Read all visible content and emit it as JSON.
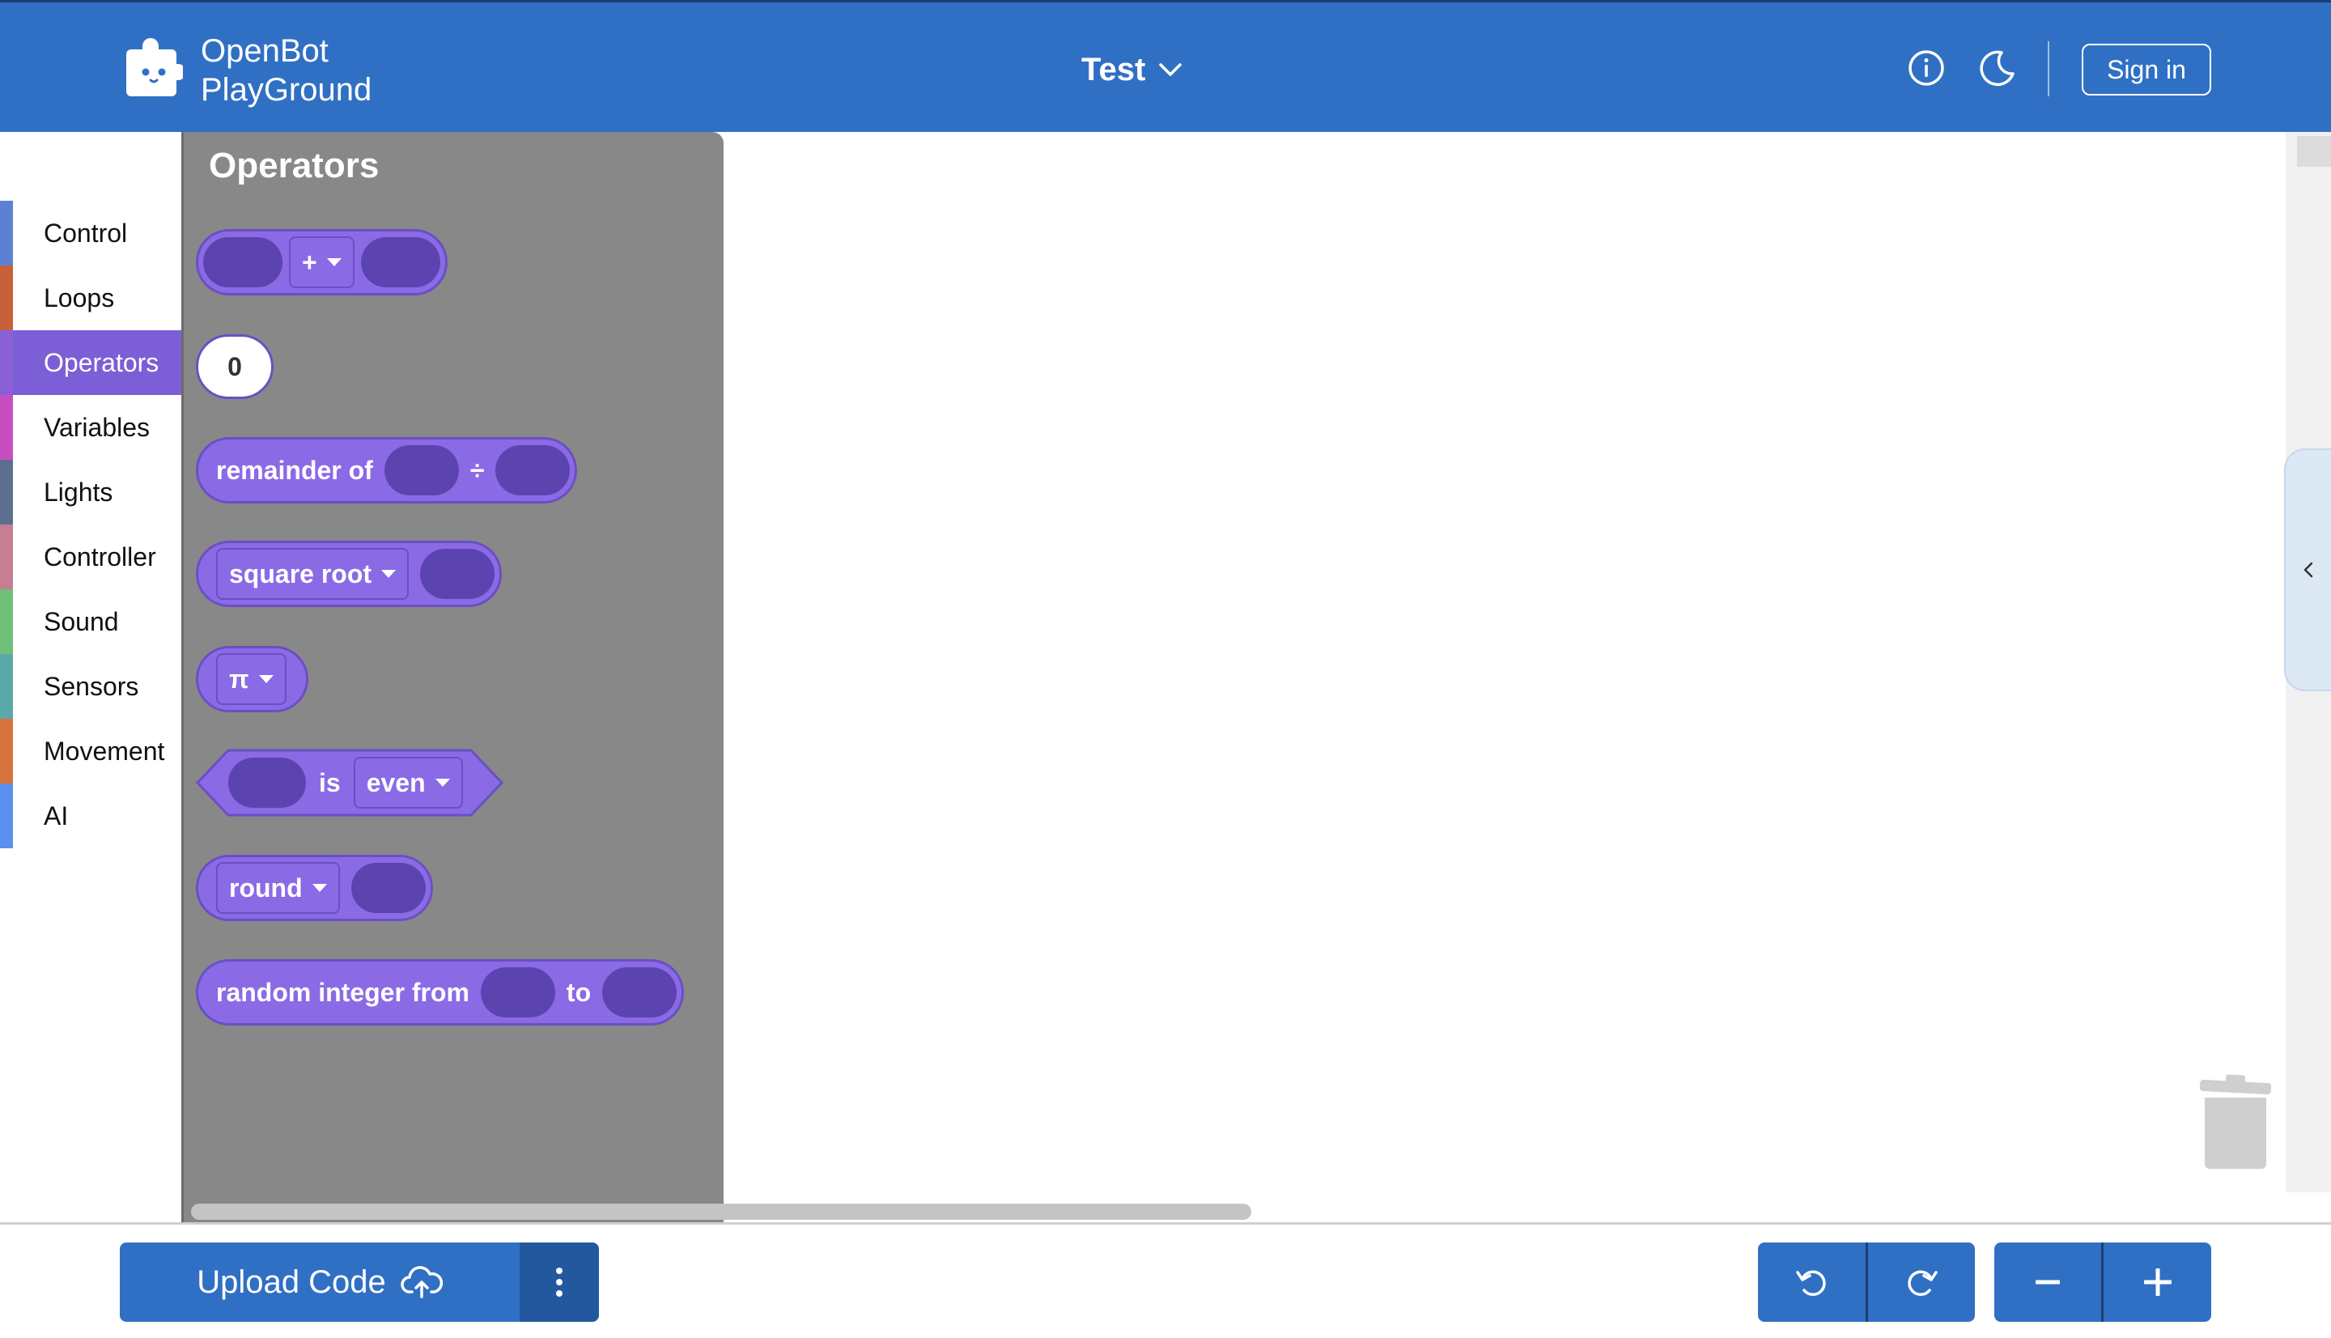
{
  "header": {
    "brand_line1": "OpenBot",
    "brand_line2": "PlayGround",
    "project_name": "Test",
    "sign_in_label": "Sign in",
    "icons": [
      "puzzle-logo-icon",
      "chevron-down-icon",
      "info-icon",
      "moon-icon"
    ]
  },
  "toolbox": {
    "categories": [
      {
        "label": "Control",
        "color": "#5c81d4"
      },
      {
        "label": "Loops",
        "color": "#c8603a"
      },
      {
        "label": "Operators",
        "color": "#8b5fd6",
        "selected": true
      },
      {
        "label": "Variables",
        "color": "#c74ec0"
      },
      {
        "label": "Lights",
        "color": "#5c6f8f"
      },
      {
        "label": "Controller",
        "color": "#c77d92"
      },
      {
        "label": "Sound",
        "color": "#6fc078"
      },
      {
        "label": "Sensors",
        "color": "#5ba8a8"
      },
      {
        "label": "Movement",
        "color": "#d9733d"
      },
      {
        "label": "AI",
        "color": "#5b8ff0"
      }
    ]
  },
  "flyout": {
    "title": "Operators",
    "arith_op": "+",
    "number_value": "0",
    "remainder_label": "remainder of",
    "remainder_op": "÷",
    "math_fn": "square root",
    "constant": "π",
    "is_label": "is",
    "parity": "even",
    "round_fn": "round",
    "random_label": "random integer from",
    "random_to": "to",
    "block_color": "#8b6ae6"
  },
  "bottom": {
    "upload_label": "Upload Code",
    "icons": [
      "cloud-upload-icon",
      "more-vertical-icon",
      "undo-icon",
      "redo-icon",
      "zoom-out-icon",
      "zoom-in-icon",
      "trash-icon",
      "collapse-chevron-icon"
    ]
  }
}
